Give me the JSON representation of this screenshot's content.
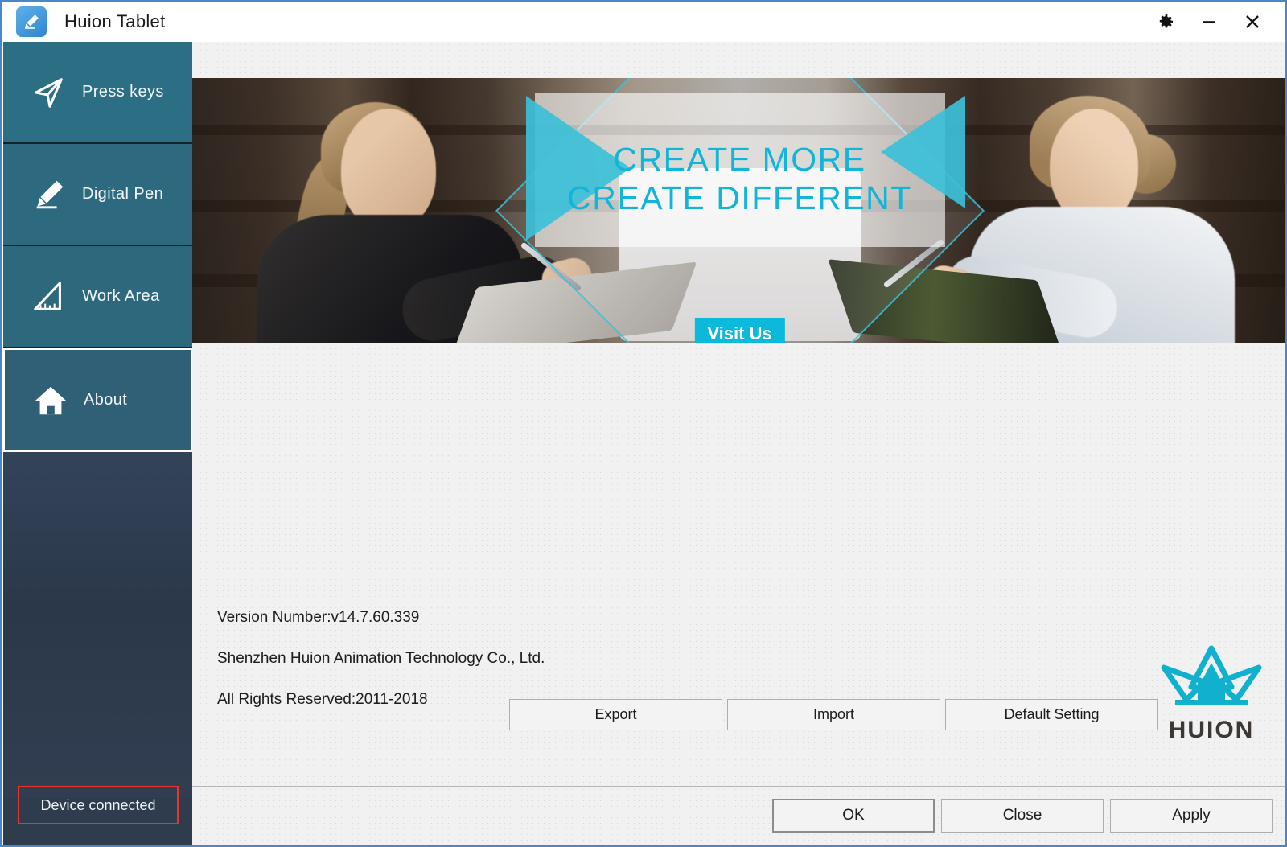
{
  "window": {
    "title": "Huion Tablet",
    "app_icon": "pen-tablet-icon",
    "accent_color": "#0bbada",
    "sidebar_color": "#2c6e84",
    "border_color": "#4a86c8"
  },
  "titlebar": {
    "settings_label": "settings-gear",
    "minimize_label": "minimize",
    "close_label": "close"
  },
  "sidebar": {
    "items": [
      {
        "label": "Press keys",
        "icon": "cursor-arrow-icon",
        "selected": false
      },
      {
        "label": "Digital Pen",
        "icon": "pencil-icon",
        "selected": false
      },
      {
        "label": "Work Area",
        "icon": "set-square-icon",
        "selected": false
      },
      {
        "label": "About",
        "icon": "home-icon",
        "selected": true
      }
    ],
    "status": {
      "text": "Device connected",
      "color": "#e8352b"
    }
  },
  "banner": {
    "headline_1": "CREATE MORE",
    "headline_2": "CREATE DIFFERENT",
    "cta_label": "Visit Us",
    "text_color": "#11b5d8",
    "cta_bg": "#0bbada"
  },
  "about": {
    "version_line": "Version Number:v14.7.60.339",
    "company_line": "Shenzhen Huion Animation Technology Co., Ltd.",
    "rights_line": "All Rights Reserved:2011-2018",
    "buttons": [
      {
        "label": "Export"
      },
      {
        "label": "Import"
      },
      {
        "label": "Default Setting"
      }
    ],
    "logo": {
      "wordmark": "HUION",
      "mark": "crown-icon",
      "mark_color": "#12b0cf"
    }
  },
  "footer": {
    "buttons": [
      {
        "label": "OK",
        "is_default": true
      },
      {
        "label": "Close",
        "is_default": false
      },
      {
        "label": "Apply",
        "is_default": false
      }
    ]
  }
}
